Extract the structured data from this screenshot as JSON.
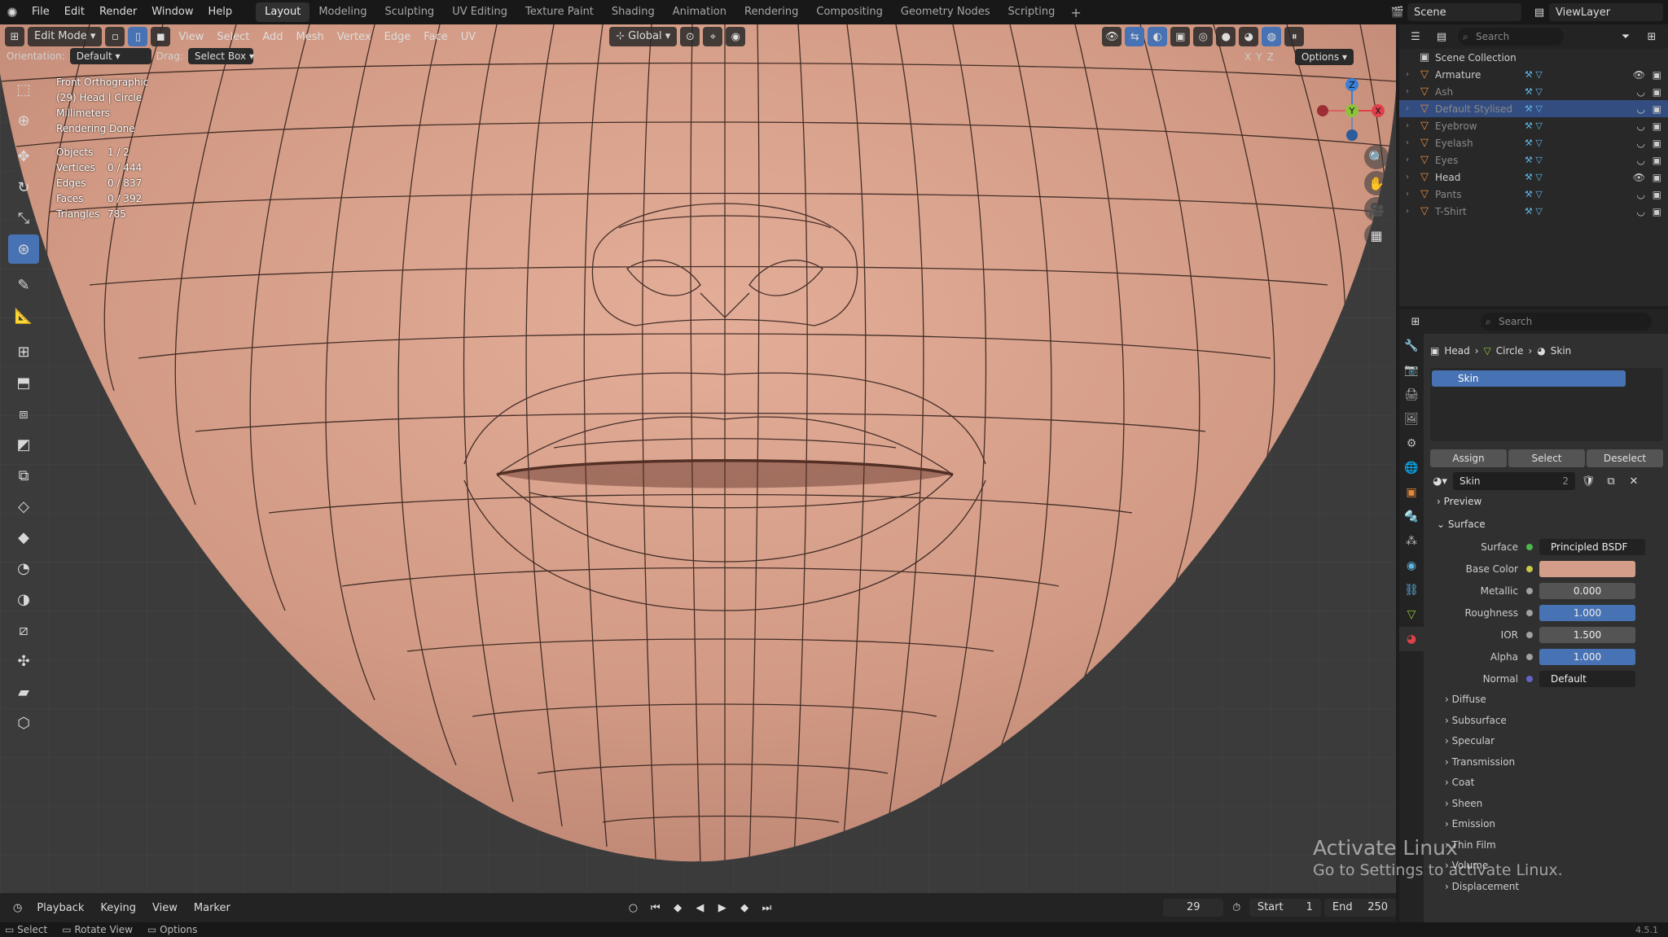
{
  "menu": {
    "items": [
      "File",
      "Edit",
      "Render",
      "Window",
      "Help"
    ],
    "workspaces": [
      "Layout",
      "Modeling",
      "Sculpting",
      "UV Editing",
      "Texture Paint",
      "Shading",
      "Animation",
      "Rendering",
      "Compositing",
      "Geometry Nodes",
      "Scripting"
    ],
    "active_workspace": "Layout",
    "add_tab": "+",
    "scene": "Scene",
    "view_layer": "ViewLayer"
  },
  "viewport_header": {
    "mode": "Edit Mode",
    "menus": [
      "View",
      "Select",
      "Add",
      "Mesh",
      "Vertex",
      "Edge",
      "Face",
      "UV"
    ],
    "transform_orientation": "Global",
    "options_label": "Options",
    "axes": [
      "X",
      "Y",
      "Z"
    ]
  },
  "tool_settings": {
    "orientation_label": "Orientation:",
    "orientation_value": "Default",
    "drag_label": "Drag:",
    "drag_value": "Select Box"
  },
  "overlay": {
    "view_name": "Front Orthographic",
    "object_info": "(29) Head | Circle",
    "units": "Millimeters",
    "render_status": "Rendering Done",
    "stats": [
      {
        "label": "Objects",
        "value": "1 / 2"
      },
      {
        "label": "Vertices",
        "value": "0 / 444"
      },
      {
        "label": "Edges",
        "value": "0 / 837"
      },
      {
        "label": "Faces",
        "value": "0 / 392"
      },
      {
        "label": "Triangles",
        "value": "785"
      }
    ]
  },
  "gizmo": {
    "x": "X",
    "y": "Y",
    "z": "Z"
  },
  "timeline": {
    "menus": [
      "Playback",
      "Keying",
      "View",
      "Marker"
    ],
    "current_frame": "29",
    "start_label": "Start",
    "start_value": "1",
    "end_label": "End",
    "end_value": "250"
  },
  "statusbar": {
    "items": [
      "Select",
      "Rotate View",
      "Options"
    ],
    "version": "4.5.1"
  },
  "outliner": {
    "search_placeholder": "Search",
    "collection": "Scene Collection",
    "rows": [
      {
        "name": "Armature",
        "muted": false,
        "selected": false
      },
      {
        "name": "Ash",
        "muted": true,
        "selected": false
      },
      {
        "name": "Default Stylised",
        "muted": true,
        "selected": true
      },
      {
        "name": "Eyebrow",
        "muted": true,
        "selected": false
      },
      {
        "name": "Eyelash",
        "muted": true,
        "selected": false
      },
      {
        "name": "Eyes",
        "muted": true,
        "selected": false
      },
      {
        "name": "Head",
        "muted": false,
        "selected": false
      },
      {
        "name": "Pants",
        "muted": true,
        "selected": false
      },
      {
        "name": "T-Shirt",
        "muted": true,
        "selected": false
      }
    ]
  },
  "properties": {
    "search_placeholder": "Search",
    "breadcrumb": [
      "Head",
      "Circle",
      "Skin"
    ],
    "material_slot": "Skin",
    "buttons": [
      "Assign",
      "Select",
      "Deselect"
    ],
    "material_name": "Skin",
    "user_count": "2",
    "panels": {
      "preview": "Preview",
      "surface": "Surface"
    },
    "surface": {
      "label": "Surface",
      "value": "Principled BSDF"
    },
    "fields": [
      {
        "label": "Base Color",
        "value": "",
        "style": "color",
        "color": "#d39d8a"
      },
      {
        "label": "Metallic",
        "value": "0.000",
        "style": "normal"
      },
      {
        "label": "Roughness",
        "value": "1.000",
        "style": "blue"
      },
      {
        "label": "IOR",
        "value": "1.500",
        "style": "normal"
      },
      {
        "label": "Alpha",
        "value": "1.000",
        "style": "blue"
      },
      {
        "label": "Normal",
        "value": "Default",
        "style": "dark"
      }
    ],
    "subpanels": [
      "Diffuse",
      "Subsurface",
      "Specular",
      "Transmission",
      "Coat",
      "Sheen",
      "Emission",
      "Thin Film",
      "Volume",
      "Displacement"
    ]
  },
  "watermark": {
    "title": "Activate Linux",
    "subtitle": "Go to Settings to activate Linux."
  },
  "colors": {
    "accent": "#4772b3",
    "skin": "#d9a28c",
    "axis_x": "#e0404a",
    "axis_y": "#8bc43a",
    "axis_z": "#3a7fd6"
  }
}
